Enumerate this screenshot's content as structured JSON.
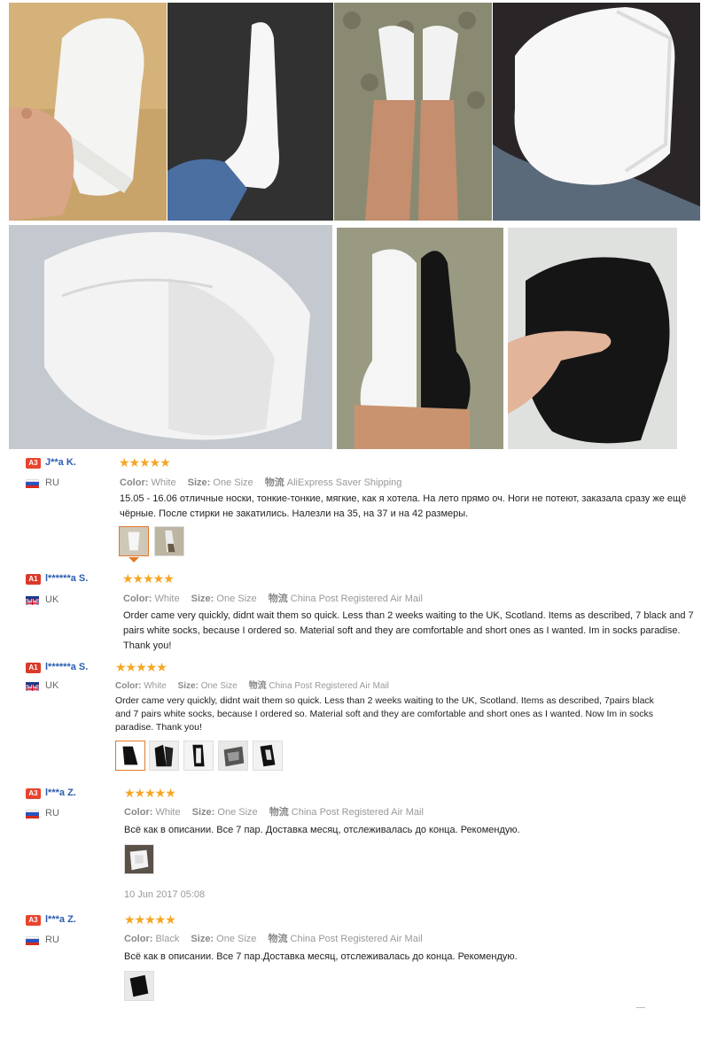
{
  "colors": {
    "accent": "#e07a2a",
    "star": "#f5a623",
    "username": "#2a5db0",
    "badge": "#e8432d"
  },
  "photos": [
    {
      "name": "white-sock-hand-photo"
    },
    {
      "name": "white-sock-foot-dark-rug-photo"
    },
    {
      "name": "white-socks-legs-photo"
    },
    {
      "name": "white-socks-pile-photo"
    },
    {
      "name": "white-socks-closeup-photo"
    },
    {
      "name": "white-and-black-sock-photo"
    },
    {
      "name": "black-socks-hand-photo"
    }
  ],
  "reviews": [
    {
      "badge": "A3",
      "user": "J**a K.",
      "country": "RU",
      "stars": "★★★★★",
      "color_label": "Color:",
      "color": "White",
      "size_label": "Size:",
      "size": "One Size",
      "ship_label": "物流",
      "shipping": "AliExpress Saver Shipping",
      "text": "15.05 - 16.06 отличные носки, тонкие-тонкие, мягкие, как я хотела. На лето прямо оч. Ноги не потеют, заказала сразу же ещё чёрные. После стирки не закатились. Налезли на 35, на 37 и на 42 размеры.",
      "date": ""
    },
    {
      "badge": "A1",
      "user": "l******a S.",
      "country": "UK",
      "stars": "★★★★★",
      "color_label": "Color:",
      "color": "White",
      "size_label": "Size:",
      "size": "One Size",
      "ship_label": "物流",
      "shipping": "China Post Registered Air Mail",
      "text": "Order came very quickly, didnt wait them so quick. Less than 2 weeks waiting to the UK, Scotland. Items as described, 7 black and 7 pairs white socks, because I ordered so. Material soft and they are comfortable and short ones as I wanted. Im in socks paradise. Thank you!",
      "date": ""
    },
    {
      "badge": "A1",
      "user": "l******a S.",
      "country": "UK",
      "stars": "★★★★★",
      "color_label": "Color:",
      "color": "White",
      "size_label": "Size:",
      "size": "One Size",
      "ship_label": "物流",
      "shipping": "China Post Registered Air Mail",
      "text": "Order came very quickly, didnt wait them so quick. Less than 2 weeks waiting to the UK, Scotland. Items as described, 7pairs black and 7 pairs white socks, because I ordered so. Material soft and they are comfortable and short ones as I wanted. Now Im in socks paradise. Thank you!",
      "date": ""
    },
    {
      "badge": "A3",
      "user": "l***a Z.",
      "country": "RU",
      "stars": "★★★★★",
      "color_label": "Color:",
      "color": "White",
      "size_label": "Size:",
      "size": "One Size",
      "ship_label": "物流",
      "shipping": "China Post Registered Air Mail",
      "text": "Всё как в описании. Все 7 пар. Доставка месяц, отслеживалась до конца. Рекомендую.",
      "date": "10 Jun 2017 05:08"
    },
    {
      "badge": "A3",
      "user": "l***a Z.",
      "country": "RU",
      "stars": "★★★★★",
      "color_label": "Color:",
      "color": "Black",
      "size_label": "Size:",
      "size": "One Size",
      "ship_label": "物流",
      "shipping": "China Post Registered Air Mail",
      "text": "Всё как в описании. Все 7 пар.Доставка месяц, отслеживалась до конца. Рекомендую.",
      "date": ""
    }
  ]
}
